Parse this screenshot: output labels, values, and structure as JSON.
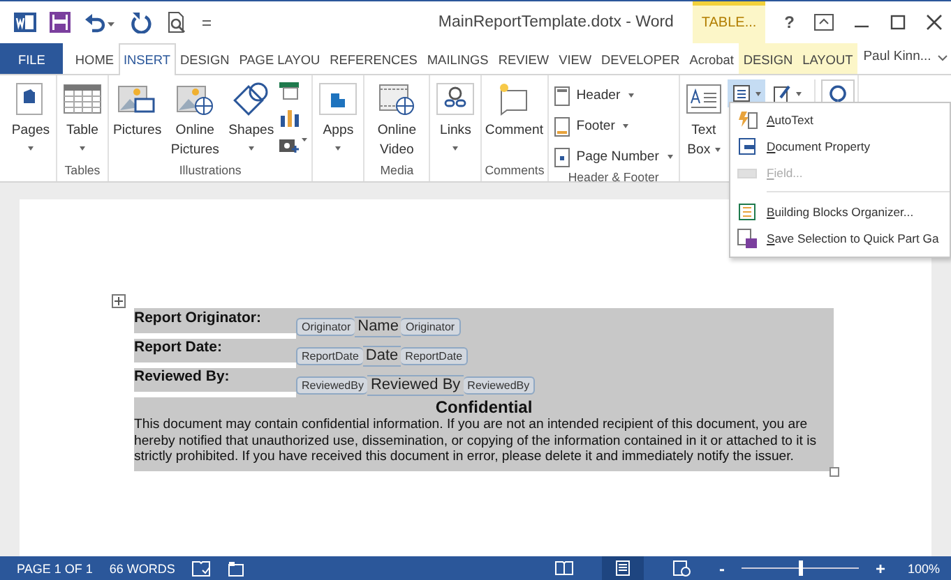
{
  "title_bar": {
    "title": "MainReportTemplate.dotx - Word",
    "contextual_header": "TABLE...",
    "help": "?"
  },
  "tabs": [
    {
      "label": "FILE",
      "kind": "file",
      "selected": false
    },
    {
      "label": "HOME",
      "kind": "normal",
      "selected": false
    },
    {
      "label": "INSERT",
      "kind": "normal",
      "selected": true
    },
    {
      "label": "DESIGN",
      "kind": "normal",
      "selected": false
    },
    {
      "label": "PAGE LAYOU",
      "kind": "normal",
      "selected": false
    },
    {
      "label": "REFERENCES",
      "kind": "normal",
      "selected": false
    },
    {
      "label": "MAILINGS",
      "kind": "normal",
      "selected": false
    },
    {
      "label": "REVIEW",
      "kind": "normal",
      "selected": false
    },
    {
      "label": "VIEW",
      "kind": "normal",
      "selected": false
    },
    {
      "label": "DEVELOPER",
      "kind": "normal",
      "selected": false
    },
    {
      "label": "Acrobat",
      "kind": "normal",
      "selected": false
    },
    {
      "label": "DESIGN",
      "kind": "contextual",
      "selected": false
    },
    {
      "label": "LAYOUT",
      "kind": "contextual",
      "selected": false
    }
  ],
  "user": "Paul Kinn...",
  "ribbon": {
    "groups": [
      {
        "buttons": [
          {
            "label": "Pages",
            "kind": "large",
            "dropdown": true
          }
        ]
      },
      {
        "label": "Tables",
        "buttons": [
          {
            "label": "Table",
            "kind": "large",
            "dropdown": true
          }
        ]
      },
      {
        "label": "Illustrations",
        "buttons": [
          {
            "label": "Pictures",
            "kind": "large",
            "dropdown": false
          },
          {
            "label": "Online Pictures",
            "kind": "large",
            "dropdown": false
          },
          {
            "label": "Shapes",
            "kind": "large",
            "dropdown": true
          },
          {
            "kind": "stack"
          }
        ]
      },
      {
        "buttons": [
          {
            "label": "Apps",
            "kind": "large",
            "dropdown": true
          }
        ]
      },
      {
        "label": "Media",
        "buttons": [
          {
            "label": "Online Video",
            "kind": "large",
            "dropdown": false
          }
        ]
      },
      {
        "buttons": [
          {
            "label": "Links",
            "kind": "large",
            "dropdown": true
          }
        ]
      },
      {
        "label": "Comments",
        "buttons": [
          {
            "label": "Comment",
            "kind": "large",
            "dropdown": false
          }
        ]
      },
      {
        "label": "Header & Footer",
        "buttons": [
          {
            "label": "Header",
            "kind": "small",
            "dropdown": true
          },
          {
            "label": "Footer",
            "kind": "small",
            "dropdown": true
          },
          {
            "label": "Page Number",
            "kind": "small",
            "dropdown": true
          }
        ]
      },
      {
        "buttons": [
          {
            "label": "Text Box",
            "kind": "large_inline",
            "dropdown": true
          },
          {
            "kind": "icons"
          }
        ]
      }
    ]
  },
  "quick_parts_menu": {
    "items": [
      {
        "label": "AutoText",
        "disabled": false
      },
      {
        "label": "Document Property",
        "disabled": false
      },
      {
        "label": "Field...",
        "disabled": true
      },
      {
        "label": "Building Blocks Organizer...",
        "disabled": false
      },
      {
        "label": "Save Selection to Quick Part Ga",
        "disabled": false
      }
    ]
  },
  "document": {
    "rows": [
      {
        "label": "Report Originator:",
        "start_tag": "Originator",
        "value": "Name",
        "end_tag": "Originator"
      },
      {
        "label": "Report Date:",
        "start_tag": "ReportDate",
        "value": "Date",
        "end_tag": "ReportDate"
      },
      {
        "label": "Reviewed By:",
        "start_tag": "ReviewedBy",
        "value": "Reviewed By",
        "end_tag": "ReviewedBy"
      }
    ],
    "heading": "Confidential",
    "notice": "This document may contain confidential information. If you are not an intended recipient of this document, you are hereby notified that unauthorized use, dissemination, or copying of the information contained in it or attached to it is strictly prohibited. If you have received this document in error, please delete it and immediately notify the issuer."
  },
  "status_bar": {
    "page": "PAGE 1 OF 1",
    "words": "66 WORDS",
    "views": [
      {
        "selected": false
      },
      {
        "selected": true
      },
      {
        "selected": false
      }
    ],
    "zoom": {
      "out": "-",
      "level": 0.5,
      "in": "+",
      "reading": "100%"
    }
  }
}
